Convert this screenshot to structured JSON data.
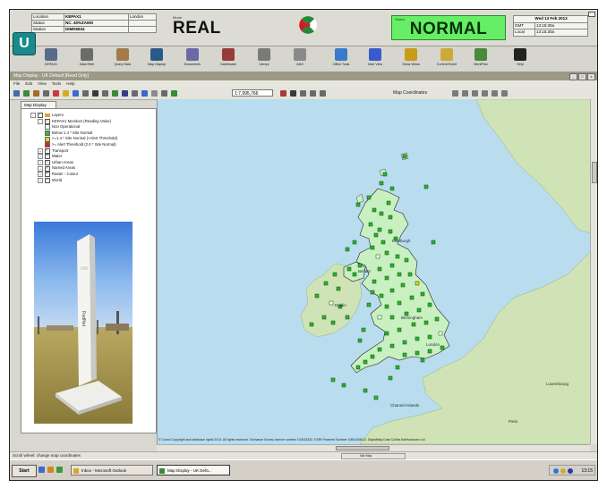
{
  "header": {
    "info_rows": [
      {
        "key": "Location",
        "value": "KEPAX1",
        "extra": "London"
      },
      {
        "key": "Status",
        "value": "NC. 40%ZAMO",
        "extra": ""
      },
      {
        "key": "Station",
        "value": "DIMD6934",
        "extra": ""
      }
    ],
    "mode_label": "Mode",
    "mode": "REAL",
    "status_label": "Status",
    "status": "NORMAL",
    "status_color": "#66ee66",
    "clock_title": "Wed 13 Feb 2013",
    "clock_rows": [
      {
        "key": "GMT",
        "value": "13:15:30a"
      },
      {
        "key": "Local",
        "value": "13:15:30a"
      }
    ]
  },
  "launcher": {
    "buttons": [
      {
        "label": "KEPAX1",
        "icon": "radiation-icon",
        "color": "#5a6a8a"
      },
      {
        "label": "Data Retri",
        "icon": "database-icon",
        "color": "#6b6b6b"
      },
      {
        "label": "Query Data",
        "icon": "chart-icon",
        "color": "#a47a4a"
      },
      {
        "label": "Map Display",
        "icon": "globe-icon",
        "color": "#2a5a8a"
      },
      {
        "label": "Documents",
        "icon": "document-icon",
        "color": "#6a6aa8"
      },
      {
        "label": "Dashboard",
        "icon": "dashboard-icon",
        "color": "#9a3a3a"
      },
      {
        "label": "Library",
        "icon": "library-icon",
        "color": "#7a7a7a"
      },
      {
        "label": "Alert",
        "icon": "warning-icon",
        "color": "#8a8a8a"
      },
      {
        "label": "Office Tools",
        "icon": "office-icon",
        "color": "#3a7acc"
      },
      {
        "label": "User View",
        "icon": "user-view-icon",
        "color": "#3a5acc"
      },
      {
        "label": "Show Views",
        "icon": "views-icon",
        "color": "#cc9a1a"
      },
      {
        "label": "Current Event",
        "icon": "event-icon",
        "color": "#ccaa3a"
      },
      {
        "label": "WorkPlan",
        "icon": "workplan-icon",
        "color": "#4a8a3a"
      },
      {
        "label": "Help",
        "icon": "help-icon",
        "color": "#222222"
      }
    ]
  },
  "window": {
    "title": "Map Display - UK Default [Read Only]",
    "minimize": "_",
    "maximize": "□",
    "close": "x",
    "menu": [
      "File",
      "Edit",
      "View",
      "Tools",
      "Help"
    ],
    "scale": "1:7,995,766",
    "coords_dropdown": "Map Coordinates"
  },
  "left_panel": {
    "tab": "Map Display",
    "tree": [
      {
        "indent": 0,
        "label": "Layers",
        "type": "folder",
        "expanded": true,
        "checked": true
      },
      {
        "indent": 1,
        "label": "KEPAX1 Monitors (Reading Value)",
        "type": "layer",
        "expanded": true,
        "checked": true
      },
      {
        "indent": 2,
        "label": "Non Operational",
        "type": "legend",
        "swatch": "#ffffff"
      },
      {
        "indent": 2,
        "label": "Below 1.4 * Site Normal",
        "type": "legend",
        "swatch": "#33bb33"
      },
      {
        "indent": 2,
        "label": ">=1.4 * Site Normal (<Alert Threshold)",
        "type": "legend",
        "swatch": "#eecc22"
      },
      {
        "indent": 2,
        "label": ">= Alert Threshold (2.0 * Site Normal)",
        "type": "legend",
        "swatch": "#dd2222"
      },
      {
        "indent": 1,
        "label": "Transport",
        "type": "layer",
        "expanded": false,
        "checked": true
      },
      {
        "indent": 1,
        "label": "Water",
        "type": "layer",
        "expanded": false,
        "checked": true
      },
      {
        "indent": 1,
        "label": "Urban Areas",
        "type": "layer",
        "expanded": false,
        "checked": true
      },
      {
        "indent": 1,
        "label": "Named Areas",
        "type": "layer",
        "expanded": false,
        "checked": true
      },
      {
        "indent": 1,
        "label": "Raster - Colour",
        "type": "layer",
        "expanded": false,
        "checked": true
      },
      {
        "indent": 1,
        "label": "World",
        "type": "layer",
        "expanded": false,
        "checked": true
      }
    ],
    "photo_caption": "RadNet"
  },
  "map": {
    "labels": [
      {
        "text": "Edinburgh"
      },
      {
        "text": "Belfast"
      },
      {
        "text": "Dublin"
      },
      {
        "text": "Birmingham"
      },
      {
        "text": "London"
      },
      {
        "text": "Paris"
      },
      {
        "text": "Luxembourg"
      },
      {
        "text": "Channel Islands"
      }
    ],
    "copyright": "© Crown Copyright and database rights 2013. All rights reserved. Ordnance Survey licence number 100022432. ESRI Powered Number 10M/1008/12. DigitalMap Data Collins Bartholomew Ltd"
  },
  "statusbar": {
    "left": "Scroll wheel: change map coordinates",
    "progress_label": "Idle Map"
  },
  "taskbar": {
    "start": "Start",
    "tasks": [
      {
        "label": "Inbox - Microsoft Outlook",
        "active": false
      },
      {
        "label": "Map Display - UK Defa...",
        "active": true
      }
    ],
    "time": "13:15"
  }
}
